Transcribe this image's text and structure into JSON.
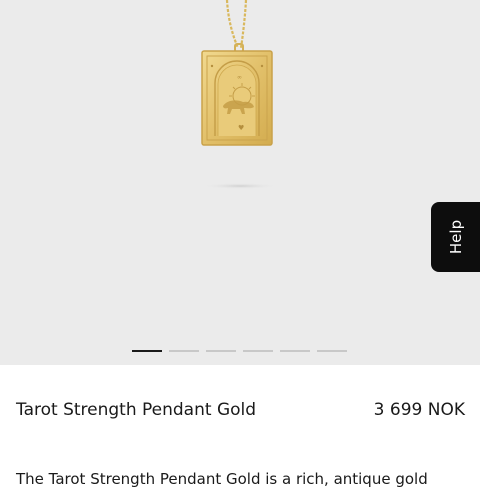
{
  "gallery": {
    "image_alt": "gold-pendant-image",
    "slide_count": 6,
    "active_slide": 1
  },
  "help_tab": {
    "label": "Help"
  },
  "product": {
    "name": "Tarot Strength Pendant Gold",
    "price": "3 699 NOK",
    "description": "The Tarot Strength Pendant Gold is a rich, antique gold"
  },
  "colors": {
    "gold": "#e4c36d",
    "background_gray": "#ebebeb",
    "text": "#1a1a1a",
    "help_bg": "#0d0d0d"
  }
}
